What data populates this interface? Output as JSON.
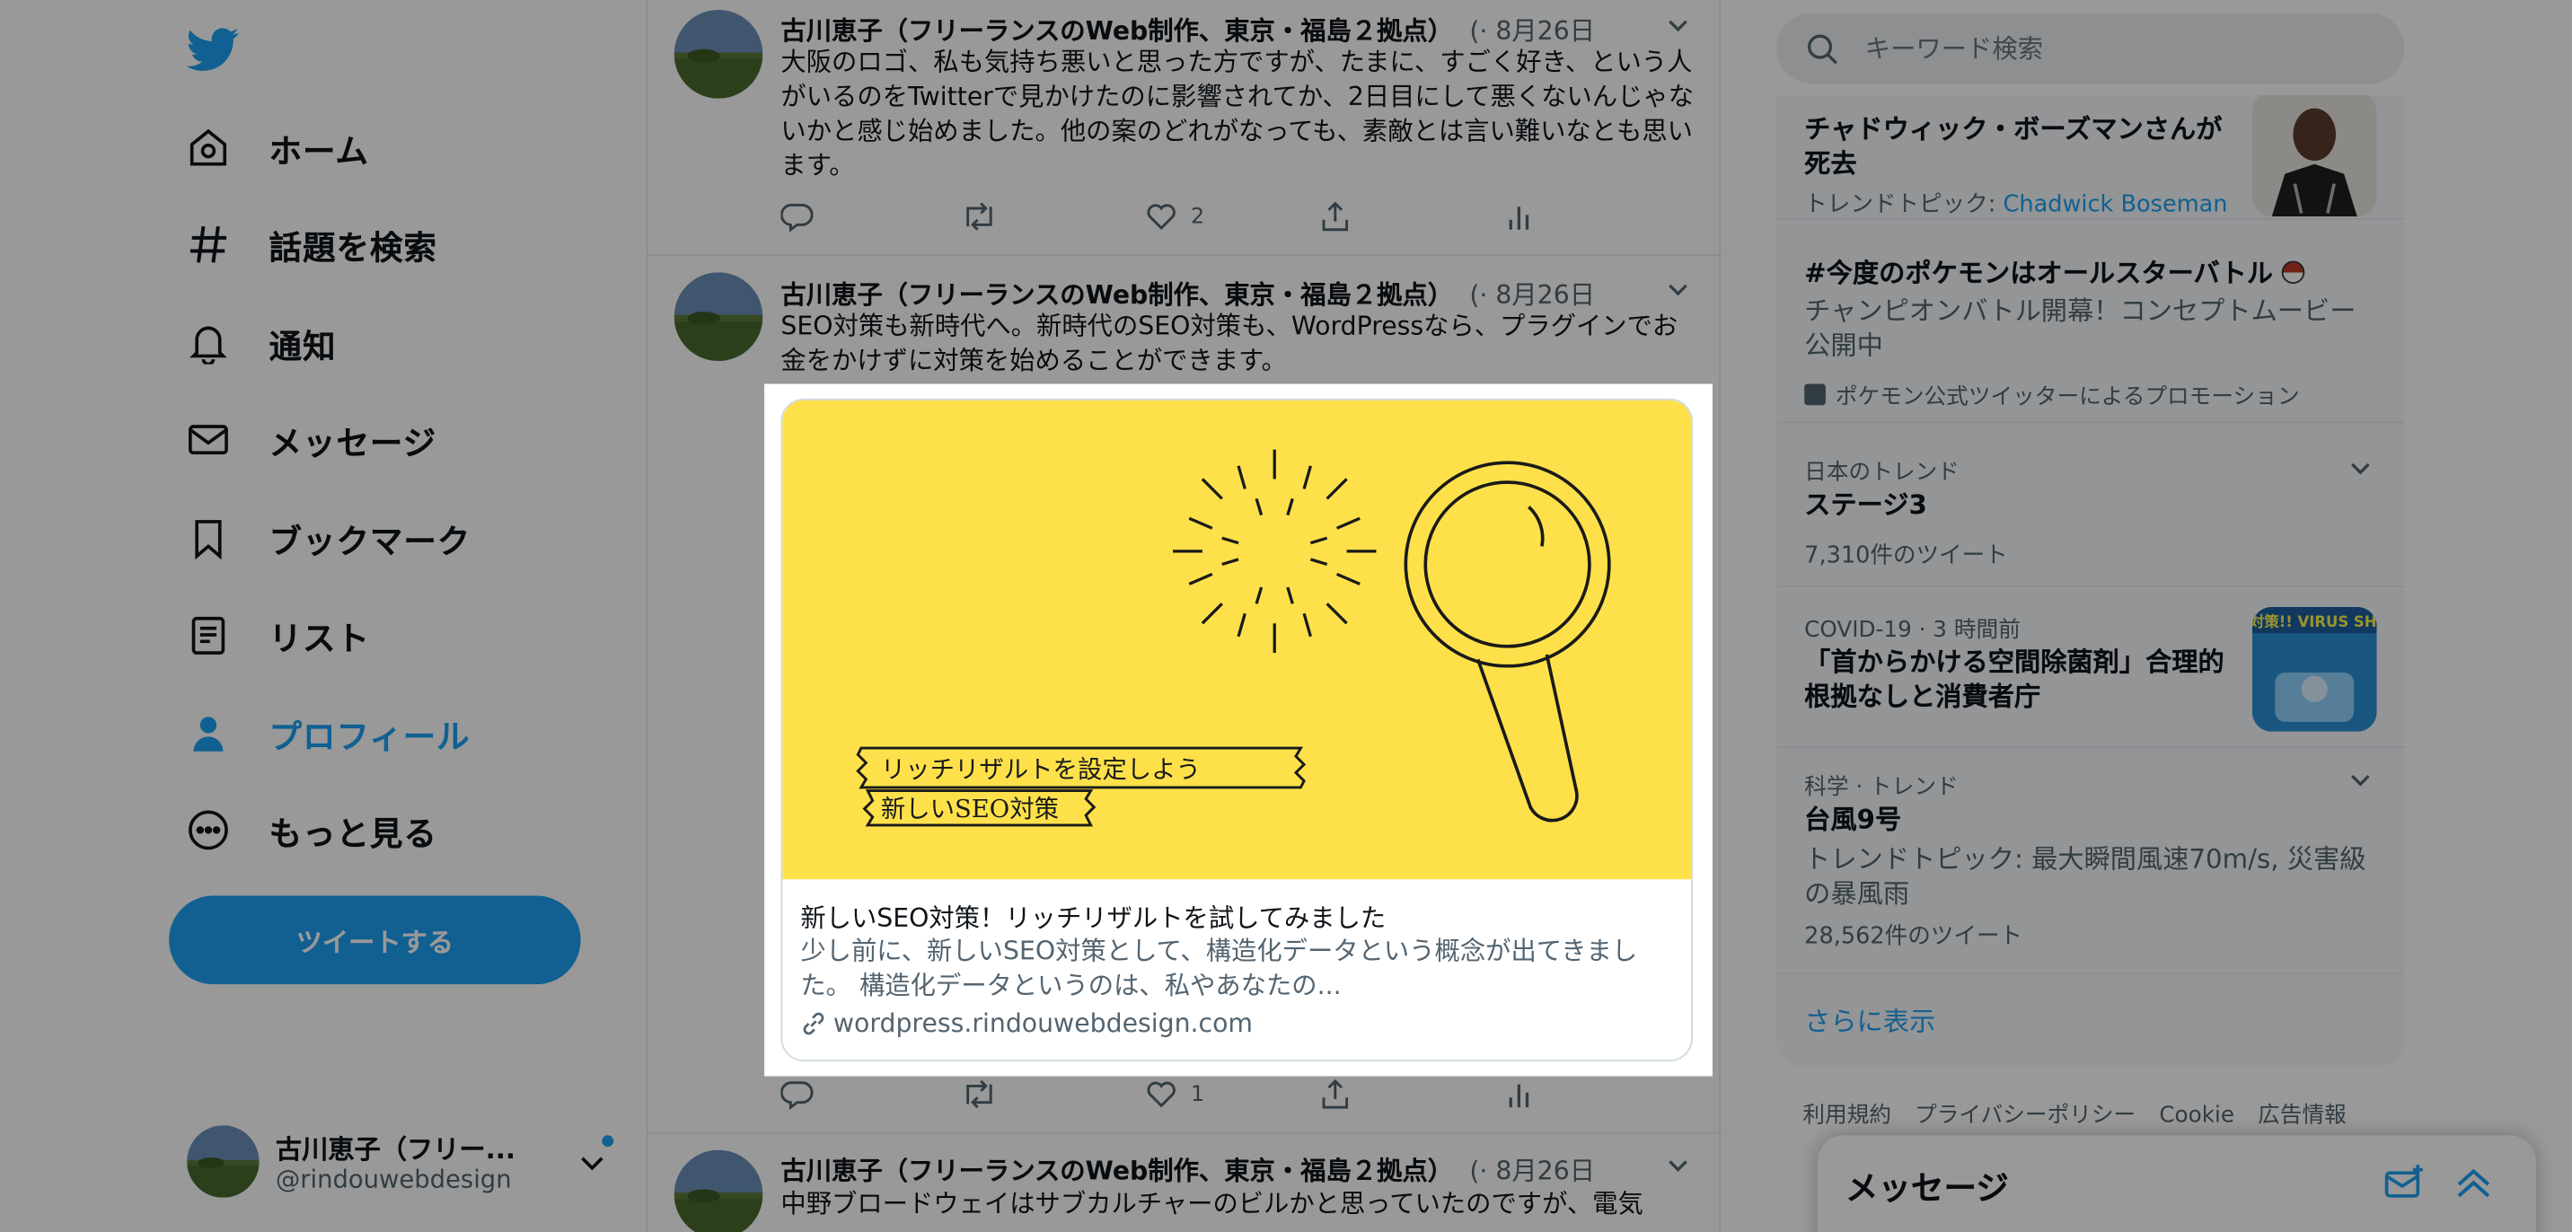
{
  "nav": {
    "items": [
      {
        "label": "ホーム",
        "icon": "home-icon"
      },
      {
        "label": "話題を検索",
        "icon": "hashtag-icon"
      },
      {
        "label": "通知",
        "icon": "bell-icon"
      },
      {
        "label": "メッセージ",
        "icon": "mail-icon"
      },
      {
        "label": "ブックマーク",
        "icon": "bookmark-icon"
      },
      {
        "label": "リスト",
        "icon": "list-icon"
      },
      {
        "label": "プロフィール",
        "icon": "person-icon",
        "active": true
      },
      {
        "label": "もっと見る",
        "icon": "more-circle-icon"
      }
    ],
    "tweet_button": "ツイートする",
    "account": {
      "name": "古川恵子（フリー...",
      "handle": "@rindouwebdesign"
    }
  },
  "timeline": {
    "tweets": [
      {
        "name": "古川恵子（フリーランスのWeb制作、東京・福島２拠点）",
        "meta": "(· 8月26日",
        "text": "大阪のロゴ、私も気持ち悪いと思った方ですが、たまに、すごく好き、という人がいるのをTwitterで見かけたのに影響されてか、2日目にして悪くないんじゃないかと感じ始めました。他の案のどれがなっても、素敵とは言い難いなとも思います。",
        "likes": "2"
      },
      {
        "name": "古川恵子（フリーランスのWeb制作、東京・福島２拠点）",
        "meta": "(· 8月26日",
        "text": "SEO対策も新時代へ。新時代のSEO対策も、WordPressなら、プラグインでお金をかけずに対策を始めることができます。",
        "likes": "1",
        "card": {
          "image_line1": "リッチリザルトを設定しよう",
          "image_line2": "新しいSEO対策",
          "title": "新しいSEO対策！リッチリザルトを試してみました",
          "description": "少し前に、新しいSEO対策として、構造化データという概念が出てきました。 構造化データというのは、私やあなたの...",
          "domain": "wordpress.rindouwebdesign.com"
        }
      },
      {
        "name": "古川恵子（フリーランスのWeb制作、東京・福島２拠点）",
        "meta": "(· 8月26日",
        "text": "中野ブロードウェイはサブカルチャーのビルかと思っていたのですが、電気"
      }
    ]
  },
  "search": {
    "placeholder": "キーワード検索"
  },
  "trends": {
    "items": [
      {
        "title": "チャドウィック・ボーズマンさんが死去",
        "sub": "トレンドトピック: ",
        "sub_link": "Chadwick Boseman"
      },
      {
        "title": "#今度のポケモンはオールスターバトル",
        "desc": "チャンピオンバトル開幕！コンセプトムービー公開中",
        "promo": "ポケモン公式ツイッターによるプロモーション"
      },
      {
        "category": "日本のトレンド",
        "title": "ステージ3",
        "count": "7,310件のツイート"
      },
      {
        "category": "COVID-19 · 3 時間前",
        "title": "「首からかける空間除菌剤」合理的根拠なしと消費者庁",
        "thumb_text": "ウイルス対策!! VIRUS SHUT OUT"
      },
      {
        "category": "科学 · トレンド",
        "title": "台風9号",
        "desc": "トレンドトピック: 最大瞬間風速70m/s, 災害級の暴風雨",
        "count": "28,562件のツイート"
      }
    ],
    "show_more": "さらに表示"
  },
  "footer": {
    "links": [
      "利用規約",
      "プライバシーポリシー",
      "Cookie",
      "広告情報"
    ]
  },
  "messages": {
    "title": "メッセージ"
  },
  "colors": {
    "accent": "#1da1f2",
    "card_yellow": "#fee14a",
    "dim": "rgba(0,0,0,0.4)"
  }
}
